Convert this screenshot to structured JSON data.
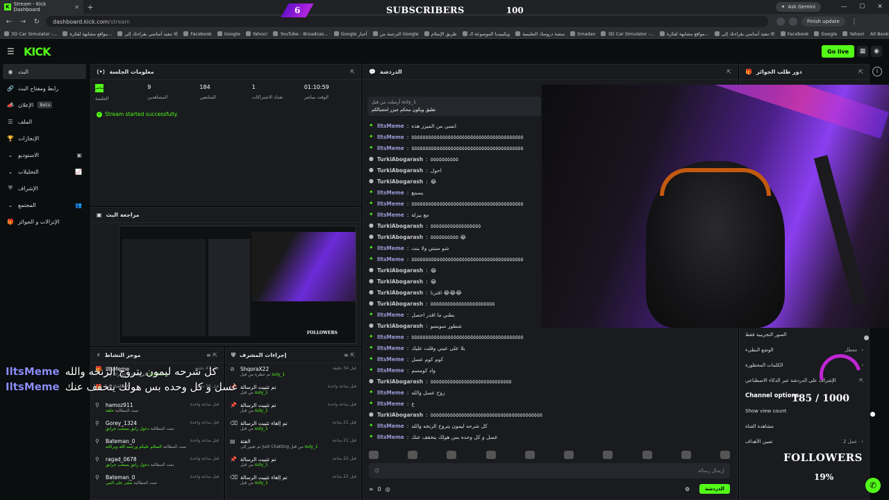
{
  "browser": {
    "tab_title": "Stream - Kick Dashboard",
    "url_host": "dashboard.kick.com",
    "url_path": "/stream",
    "gemini": "Ask Gemini",
    "finish_update": "Finish update",
    "bookmarks": [
      "3D Car Simulator -...",
      "مواقع مشابهة لفكرة...",
      "تنفيذ أساسي بقراءتك إلى IE",
      "Facebook",
      "Google",
      "Yahoo!",
      "YouTube - Broadcas...",
      "Google أخبار",
      "الترجمة من Google",
      "طريق الإسلام",
      "ويكيبيديا الموسوعة الـ",
      "منصة دروسك التعليمية",
      "Smadav",
      "3D Car Simulator -...",
      "مواقع مشابهة لفكرة...",
      "تنفيذ أساسي بقراءتك إلى IE",
      "Facebook",
      "Google",
      "Yahoo!"
    ],
    "all_bookmarks": "All Bookmarks"
  },
  "subs_overlay": {
    "count": "6",
    "label": "SUBSCRIBERS",
    "goal": "100"
  },
  "header": {
    "logo": "KICK",
    "go_live": "Go live"
  },
  "sidebar": {
    "items": [
      {
        "label": "البث",
        "icon": "broadcast-icon"
      },
      {
        "label": "رابط ومفتاح البث",
        "icon": "link-icon"
      },
      {
        "label": "الإعلان",
        "badge": "Beta",
        "icon": "megaphone-icon"
      },
      {
        "label": "الملف",
        "icon": "profile-icon"
      },
      {
        "label": "الإنجازات",
        "icon": "trophy-icon"
      },
      {
        "label": "الاستوديو",
        "icon": "studio-icon"
      },
      {
        "label": "التحليلات",
        "icon": "analytics-icon"
      },
      {
        "label": "الإشراف",
        "icon": "shield-icon"
      },
      {
        "label": "المجتمع",
        "icon": "community-icon"
      },
      {
        "label": "الإنزالات و الجوائز",
        "icon": "gift-icon"
      }
    ]
  },
  "session": {
    "title": "معلومات الجلسة",
    "live_badge": "مباشر",
    "session_label": "الجلسة",
    "stats": [
      {
        "value": "9",
        "label": "المشاهدين"
      },
      {
        "value": "184",
        "label": "المتابعين"
      },
      {
        "value": "1",
        "label": "تعداد الاشتراكات"
      },
      {
        "value": "01:10:59",
        "label": "الوقت مباشر"
      }
    ],
    "success": "Stream started successfully."
  },
  "preview": {
    "title": "مراجعة البث",
    "followers_text": "FOLLOWERS"
  },
  "activity": {
    "title": "موجز النشاط",
    "rows": [
      {
        "user": "IltsMeme",
        "desc": "قام بإهداء 1 اشتراك إلى",
        "target": "IltsMeme",
        "time": "قبل 47 دقيقة"
      },
      {
        "user": "",
        "desc": "تابع القناة للتو",
        "target": "",
        "time": "قبل 59 دقيقة"
      },
      {
        "user": "hamoz911",
        "desc": "تمت المطالبة",
        "target": "حلقة",
        "time": "قبل ساعة واحدة"
      },
      {
        "user": "Gorey_1324",
        "desc": "تمت المطالبة",
        "target": "دخول رابق يسجب حرابق",
        "time": "قبل ساعة واحدة"
      },
      {
        "user": "Bateman_0",
        "desc": "تمت المطالبة",
        "target": "السلام عليكم ورحمه الله وبركاته",
        "time": "قبل ساعة واحدة"
      },
      {
        "user": "ragad_0678",
        "desc": "تمت المطالبة",
        "target": "دخول رابق يسجب حرابق",
        "time": "قبل ساعة واحدة"
      },
      {
        "user": "Bateman_0",
        "desc": "تمت المطالبة",
        "target": "صلى على النبي",
        "time": "قبل ساعة واحدة"
      }
    ]
  },
  "mod": {
    "title": "إجراءات المشرف",
    "rows": [
      {
        "user": "ShqoraX22",
        "desc": "تم حظره من قبل",
        "by": "suly_1",
        "time": "قبل 34 دقيقة"
      },
      {
        "user": "تم تثبيت الرسالة",
        "desc": "من قبل",
        "by": "suly_1",
        "time": "قبل ساعة واحدة"
      },
      {
        "user": "تم تثبيت الرسالة",
        "desc": "من قبل",
        "by": "suly_1",
        "time": "قبل ساعة واحدة"
      },
      {
        "user": "تم إلغاء تثبيت الرسالة",
        "desc": "من قبل",
        "by": "suly_1",
        "time": "قبل 21 ساعة"
      },
      {
        "user": "الفئة",
        "desc": "تم تغيير إلى Just Chatting من قبل",
        "by": "suly_1",
        "time": "قبل 21 ساعة"
      },
      {
        "user": "تم تثبيت الرسالة",
        "desc": "من قبل",
        "by": "suly_1",
        "time": "قبل 22 ساعة"
      },
      {
        "user": "تم إلغاء تثبيت الرسالة",
        "desc": "من قبل",
        "by": "suly_1",
        "time": "قبل 22 ساعة"
      }
    ]
  },
  "chat": {
    "title": "الدردشة",
    "pinned": {
      "meta": "أرسلت من قبل suly_1",
      "msg": "تقليق ويكون محكم جيزر لحجبالكم"
    },
    "lines": [
      {
        "user": "IltsMeme",
        "msg": "انسى من الميزز هذه"
      },
      {
        "user": "IltsMeme",
        "msg": "٥٥٥٥٥٥٥٥٥٥٥٥٥٥٥٥٥٥٥٥٥٥٥٥٥٥٥٥٥٥٥٥٥٥٥٥٥٥٥٥"
      },
      {
        "user": "IltsMeme",
        "msg": "٥٥٥٥٥٥٥٥٥٥٥٥٥٥٥٥٥٥٥٥٥٥٥٥٥٥٥٥٥٥٥٥٥٥٥٥٥٥٥٥"
      },
      {
        "user": "TurkiAbogarash",
        "msg": "٥٥٥٥٥٥٥٥٥٥"
      },
      {
        "user": "TurkiAbogarash",
        "msg": "احول"
      },
      {
        "user": "TurkiAbogarash",
        "msg": "😂"
      },
      {
        "user": "IltsMeme",
        "msg": "يسمع"
      },
      {
        "user": "IltsMeme",
        "msg": "٥٥٥٥٥٥٥٥٥٥٥٥٥٥٥٥٥٥٥٥٥٥٥٥٥٥٥٥٥٥٥٥٥٥٥٥٥٥٥٥"
      },
      {
        "user": "IltsMeme",
        "msg": "مع بيزلة"
      },
      {
        "user": "TurkiAbogarash",
        "msg": "٥٥٥٥٥٥٥٥٥٥٥٥٥٥٥٥٥٥"
      },
      {
        "user": "TurkiAbogarash",
        "msg": "٥٥٥٥٥٥٥٥٥٥ 😂"
      },
      {
        "user": "IltsMeme",
        "msg": "شو سنتي ولا بنت"
      },
      {
        "user": "IltsMeme",
        "msg": "٥٥٥٥٥٥٥٥٥٥٥٥٥٥٥٥٥٥٥٥٥٥٥٥٥٥٥٥٥٥٥٥٥٥٥٥٥٥٥٥"
      },
      {
        "user": "TurkiAbogarash",
        "msg": "😂"
      },
      {
        "user": "TurkiAbogarash",
        "msg": "😂"
      },
      {
        "user": "TurkiAbogarash",
        "msg": "اقترنا 😂😂😂"
      },
      {
        "user": "TurkiAbogarash",
        "msg": "٥٥٥٥٥٥٥٥٥٥٥٥٥٥٥٥٥٥٥٥٥٥٥"
      },
      {
        "user": "IltsMeme",
        "msg": "بطني ما اقدر احصل"
      },
      {
        "user": "TurkiAbogarash",
        "msg": "شطور سويسو"
      },
      {
        "user": "IltsMeme",
        "msg": "٥٥٥٥٥٥٥٥٥٥٥٥٥٥٥٥٥٥٥٥٥٥٥٥٥٥٥٥٥٥٥٥٥٥٥٥٥٥٥٥"
      },
      {
        "user": "IltsMeme",
        "msg": "يلا على عيني وقلت عليك"
      },
      {
        "user": "IltsMeme",
        "msg": "كوم كوم عسل"
      },
      {
        "user": "IltsMeme",
        "msg": "واد كومسم"
      },
      {
        "user": "TurkiAbogarash",
        "msg": "٥٥٥٥٥٥٥٥٥٥٥٥٥٥٥٥٥٥٥٥٥٥٥٥٥٥٥٥٥"
      },
      {
        "user": "IltsMeme",
        "msg": "زوح عسل والله"
      },
      {
        "user": "IltsMeme",
        "msg": "ع"
      },
      {
        "user": "TurkiAbogarash",
        "msg": "٥٥٥٥٥٥٥٥٥٥٥٥٥٥٥٥٥٥٥٥٥٥٥٥٥٥٥٥٥٥٥٥٥٥٥٥٥٥٥٥"
      },
      {
        "user": "IltsMeme",
        "msg": "كل شرحه ليمون يتروح الزنخه والله"
      },
      {
        "user": "IltsMeme",
        "msg": "غسل و كل وحده بس هولك يتخفف عنك"
      }
    ],
    "input_placeholder": "إرسال رسالة",
    "send": "الدردشة",
    "viewer_count": "0"
  },
  "rewards": {
    "title": "دور طلب الجوائز",
    "rows": [
      {
        "label": "الصور التجريبية فقط",
        "right": ""
      },
      {
        "label": "الوضع البطيء",
        "right": "معطل"
      },
      {
        "label": "الكلمات المحظورة",
        "right": ""
      },
      {
        "label": "الإشراف على الدردشة عبر الذكاء الاصطناعي",
        "right": ""
      }
    ],
    "channel_options": "Channel options",
    "show_view_count": "Show view count",
    "channel_settings": "مشاهدة القناة",
    "goal_label": "تعيين الأهداف",
    "goal_right": "عمل 2"
  },
  "overlays": {
    "followers_progress": "185 / 1000",
    "followers_label": "FOLLOWERS",
    "followers_pct": "19%",
    "tts": [
      {
        "name": "IltsMeme",
        "text": "كل شرحه ليمون يتروح الزنخه والله"
      },
      {
        "name": "IltsMeme",
        "text": "غسل و كل وحده بس هولك يتخفف عنك"
      }
    ]
  },
  "colors": {
    "accent": "#53fc18",
    "bg": "#0b0e0f",
    "panel": "#191b1f",
    "purple": "#8a3ff0"
  }
}
